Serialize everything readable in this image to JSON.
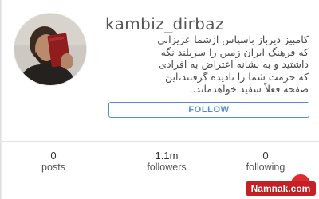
{
  "profile": {
    "username": "kambiz_dirbaz",
    "bio_lines": [
      "کامبیز دیرباز باسپاس ازشما عزیزانی",
      "که فرهنگ ایران زمین را سربلند نگه",
      "داشتید و به نشانه اعتراض به افرادی",
      "که حرمت شما را نادیده گرفتند،این",
      "صفحه فعلاً سفید خواهدماند.."
    ],
    "follow_label": "FOLLOW",
    "avatar_icon": "profile-photo"
  },
  "stats": {
    "posts_count": "0",
    "posts_label": "posts",
    "followers_count": "1.1m",
    "followers_label": "followers",
    "following_count": "0",
    "following_label": "following"
  },
  "watermark": {
    "text": "Namnak.com"
  },
  "colors": {
    "accent": "#4f90c8",
    "watermark_red": "#c62026"
  }
}
